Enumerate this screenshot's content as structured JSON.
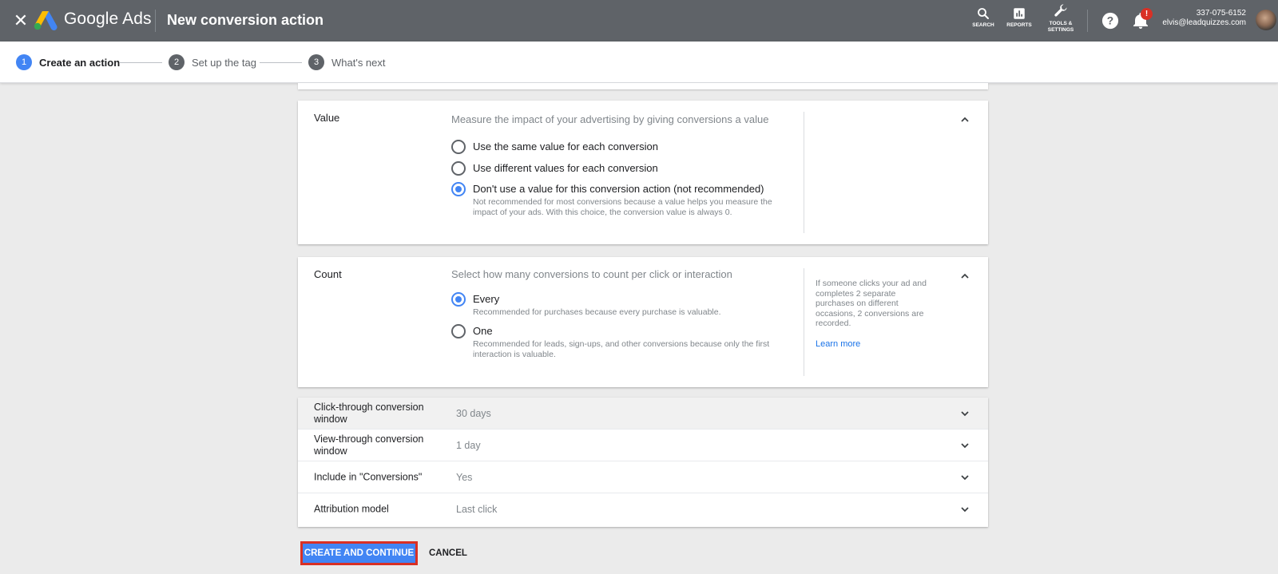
{
  "header": {
    "close_icon": "close-icon",
    "brand": "Google Ads",
    "page_title": "New conversion action",
    "search_label": "SEARCH",
    "reports_label": "REPORTS",
    "tools_label_line1": "TOOLS &",
    "tools_label_line2": "SETTINGS",
    "notification_count": "!",
    "account_phone": "337-075-6152",
    "account_email": "elvis@leadquizzes.com"
  },
  "stepper": {
    "steps": [
      {
        "number": "1",
        "label": "Create an action",
        "active": true
      },
      {
        "number": "2",
        "label": "Set up the tag",
        "active": false
      },
      {
        "number": "3",
        "label": "What's next",
        "active": false
      }
    ]
  },
  "value_section": {
    "label": "Value",
    "description": "Measure the impact of your advertising by giving conversions a value",
    "options": [
      {
        "label": "Use the same value for each conversion",
        "selected": false
      },
      {
        "label": "Use different values for each conversion",
        "selected": false
      },
      {
        "label": "Don't use a value for this conversion action (not recommended)",
        "sub": "Not recommended for most conversions because a value helps you measure the impact of your ads. With this choice, the conversion value is always 0.",
        "selected": true
      }
    ]
  },
  "count_section": {
    "label": "Count",
    "description": "Select how many conversions to count per click or interaction",
    "options": [
      {
        "label": "Every",
        "sub": "Recommended for purchases because every purchase is valuable.",
        "selected": true
      },
      {
        "label": "One",
        "sub": "Recommended for leads, sign-ups, and other conversions because only the first interaction is valuable.",
        "selected": false
      }
    ],
    "side_note": "If someone clicks your ad and completes 2 separate purchases on different occasions, 2 conversions are recorded.",
    "learn_more": "Learn more"
  },
  "settings_rows": [
    {
      "label": "Click-through conversion window",
      "value": "30 days"
    },
    {
      "label": "View-through conversion window",
      "value": "1 day"
    },
    {
      "label": "Include in \"Conversions\"",
      "value": "Yes"
    },
    {
      "label": "Attribution model",
      "value": "Last click"
    }
  ],
  "actions": {
    "primary": "CREATE AND CONTINUE",
    "cancel": "CANCEL"
  },
  "colors": {
    "topbar": "#5f6368",
    "accent": "#4285f4",
    "highlight_border": "#d93025",
    "link": "#1a73e8"
  }
}
